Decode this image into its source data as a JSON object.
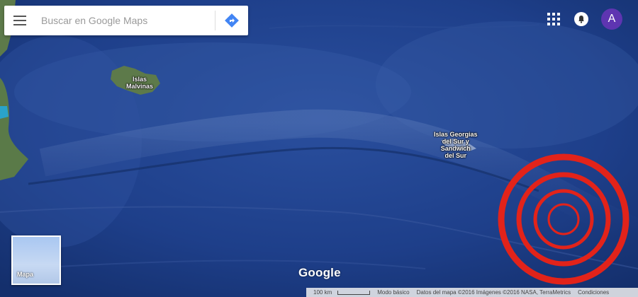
{
  "search": {
    "placeholder": "Buscar en Google Maps"
  },
  "icons": {
    "menu": "menu-icon",
    "directions": "directions-icon",
    "apps": "apps-grid-icon",
    "notifications": "bell-icon"
  },
  "account": {
    "initial": "A"
  },
  "map_labels": {
    "malvinas": "Islas\nMalvinas",
    "georgias": "Islas Georgias\ndel Sur y\nSandwich\ndel Sur"
  },
  "layer_switcher": {
    "label": "Mapa"
  },
  "brand": {
    "logo_text": "Google"
  },
  "footer": {
    "scale": "100 km",
    "mode": "Modo básico",
    "data": "Datos del mapa ©2016 Imágenes ©2016 NASA, TerraMetrics",
    "terms": "Condiciones"
  },
  "colors": {
    "ocean": "#1e3f8a",
    "ocean_dark": "#14306e",
    "land": "#5d7a4a",
    "marker_red": "#e2231a",
    "avatar": "#5e35b1"
  }
}
